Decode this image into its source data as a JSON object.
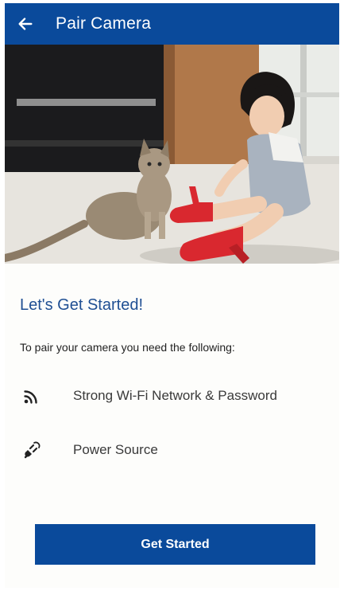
{
  "header": {
    "title": "Pair Camera",
    "back_icon": "arrow-left-icon"
  },
  "hero": {
    "alt": "Child sitting on the floor with a kitten"
  },
  "content": {
    "heading": "Let's Get Started!",
    "subtext": "To pair your camera you need the following:",
    "requirements": [
      {
        "icon": "wifi-icon",
        "label": "Strong Wi-Fi Network & Password"
      },
      {
        "icon": "power-plug-icon",
        "label": "Power Source"
      }
    ]
  },
  "actions": {
    "get_started_label": "Get Started"
  },
  "colors": {
    "primary": "#0a4a9b",
    "heading": "#1f4f93",
    "background": "#fdfdfb"
  }
}
